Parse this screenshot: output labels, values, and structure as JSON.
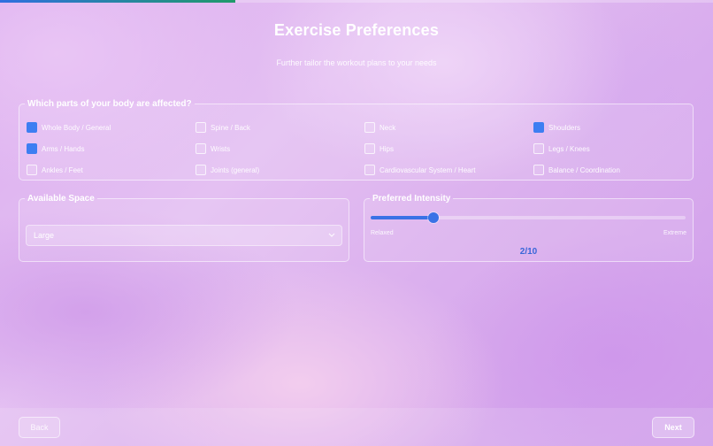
{
  "progress": {
    "fraction": 0.33
  },
  "header": {
    "title": "Exercise Preferences",
    "subtitle": "Further tailor the workout plans to your needs"
  },
  "body_parts": {
    "legend": "Which parts of your body are affected?",
    "options": [
      {
        "label": "Whole Body / General",
        "checked": true
      },
      {
        "label": "Spine / Back",
        "checked": false
      },
      {
        "label": "Neck",
        "checked": false
      },
      {
        "label": "Shoulders",
        "checked": true
      },
      {
        "label": "Arms / Hands",
        "checked": true
      },
      {
        "label": "Wrists",
        "checked": false
      },
      {
        "label": "Hips",
        "checked": false
      },
      {
        "label": "Legs / Knees",
        "checked": false
      },
      {
        "label": "Ankles / Feet",
        "checked": false
      },
      {
        "label": "Joints (general)",
        "checked": false
      },
      {
        "label": "Cardiovascular System / Heart",
        "checked": false
      },
      {
        "label": "Balance / Coordination",
        "checked": false
      }
    ]
  },
  "space": {
    "legend": "Available Space",
    "selected": "Large",
    "chevron_icon": "chevron-down-icon"
  },
  "intensity": {
    "legend": "Preferred Intensity",
    "min_label": "Relaxed",
    "max_label": "Extreme",
    "value": 2,
    "min": 0,
    "max": 10,
    "value_text": "2/10"
  },
  "footer": {
    "back_label": "Back",
    "next_label": "Next"
  },
  "colors": {
    "accent": "#3d7ef2",
    "intensity_text": "#3a66d8",
    "progress_start": "#2f6fe0",
    "progress_end": "#1f9a6a"
  }
}
